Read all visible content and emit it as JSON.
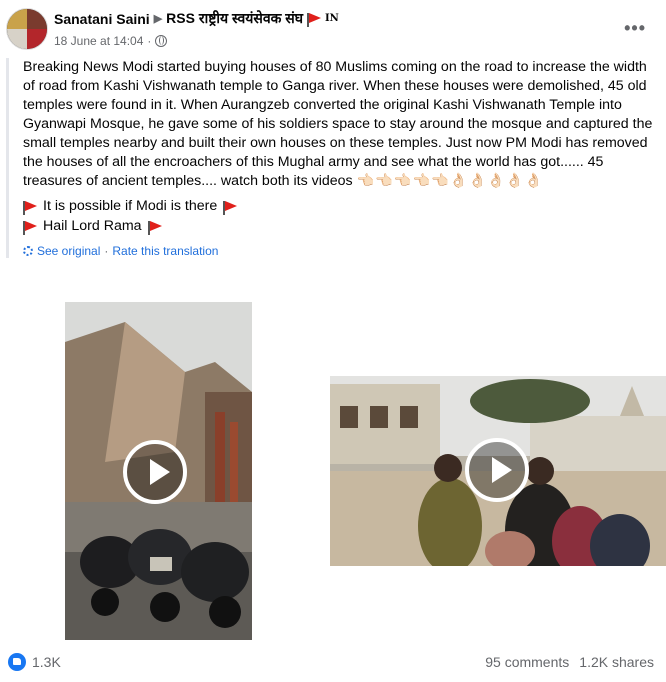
{
  "header": {
    "author": "Sanatani Saini",
    "group": "RSS राष्ट्रीय स्वयंसेवक संघ",
    "country_code": "IN",
    "timestamp": "18 June at 14:04",
    "separator": "·",
    "more_label": "•••"
  },
  "post": {
    "body": "Breaking News Modi started buying houses of 80 Muslims coming on the road to increase the width of road from Kashi Vishwanath temple to Ganga river. When these houses were demolished, 45 old temples were found in it. When Aurangzeb converted the original Kashi Vishwanath Temple into Gyanwapi Mosque, he gave some of his soldiers space to stay around the mosque and captured the small temples nearby and built their own houses on these temples. Just now PM Modi has removed the houses of all the encroachers of this Mughal army and see what the world has got...... 45 treasures of ancient temples.... watch both its videos",
    "emojis": "👈🏻👈🏻👈🏻👈🏻👈🏻👌🏻👌🏻👌🏻👌🏻👌🏻",
    "line1": "It is possible if Modi is there",
    "line2": "Hail Lord Rama",
    "see_original": "See original",
    "dot": "·",
    "rate_translation": "Rate this translation"
  },
  "videos": [
    {
      "name": "video-1",
      "icon": "play-icon"
    },
    {
      "name": "video-2",
      "icon": "play-icon"
    }
  ],
  "footer": {
    "reactions": "1.3K",
    "comments": "95 comments",
    "shares": "1.2K shares"
  },
  "colors": {
    "link": "#216fdb",
    "secondary_text": "#65676b",
    "like_blue": "#1877f2",
    "flag_red": "#e0201b"
  }
}
